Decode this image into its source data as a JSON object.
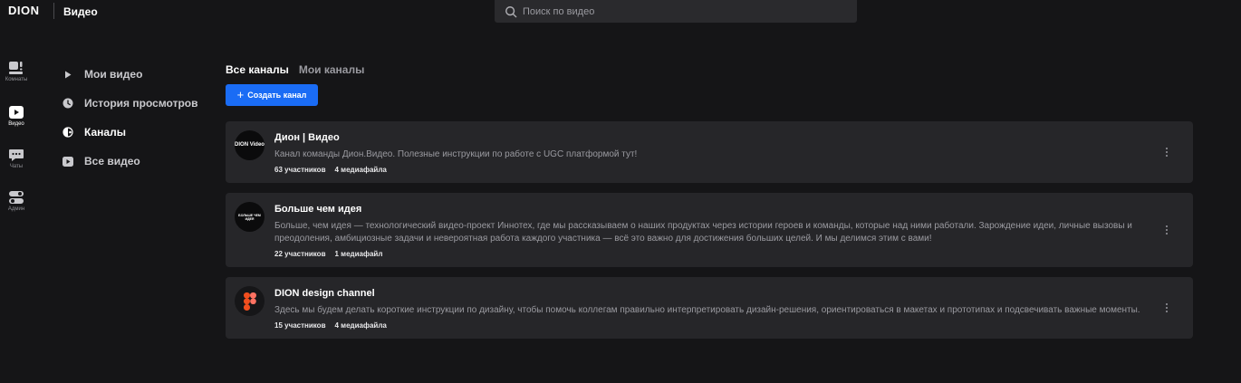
{
  "header": {
    "logo": "DION",
    "app_title": "Видео",
    "search_placeholder": "Поиск по видео"
  },
  "rail": [
    {
      "label": "Комнаты",
      "icon": "rooms-icon"
    },
    {
      "label": "Видео",
      "icon": "video-icon",
      "active": true
    },
    {
      "label": "Чаты",
      "icon": "chat-icon"
    },
    {
      "label": "Админ",
      "icon": "admin-icon"
    }
  ],
  "sidebar": {
    "items": [
      {
        "label": "Мои видео",
        "icon": "play-icon"
      },
      {
        "label": "История просмотров",
        "icon": "clock-icon"
      },
      {
        "label": "Каналы",
        "icon": "channels-icon",
        "active": true
      },
      {
        "label": "Все видео",
        "icon": "video-icon"
      }
    ]
  },
  "tabs": [
    {
      "label": "Все каналы",
      "active": true
    },
    {
      "label": "Мои каналы"
    }
  ],
  "create_button": "Создать канал",
  "channels": [
    {
      "name": "Дион | Видео",
      "avatar_text": "DION Video",
      "description": "Канал команды Дион.Видео. Полезные инструкции по работе с UGC платформой тут!",
      "members": "63 участников",
      "media": "4 медиафайла"
    },
    {
      "name": "Больше чем идея",
      "avatar_text": "БОЛЬШЕ ЧЕМ ИДЕЯ",
      "description": "Больше, чем идея — технологический видео-проект Иннотех, где мы рассказываем о наших продуктах через истории героев и команды, которые над ними работали. Зарождение идеи, личные вызовы и преодоления, амбициозные задачи и невероятная работа каждого участника — всё это важно для достижения больших целей. И мы делимся этим с вами!",
      "members": "22 участников",
      "media": "1 медиафайл"
    },
    {
      "name": "DION design channel",
      "avatar_text": "",
      "description": "Здесь мы будем делать короткие инструкции по дизайну, чтобы помочь коллегам правильно интерпретировать дизайн-решения, ориентироваться в макетах и прототипах и подсвечивать важные моменты.",
      "members": "15 участников",
      "media": "4 медиафайла"
    }
  ],
  "colors": {
    "background": "#151517",
    "card": "#262629",
    "accent": "#1a6cf5"
  }
}
